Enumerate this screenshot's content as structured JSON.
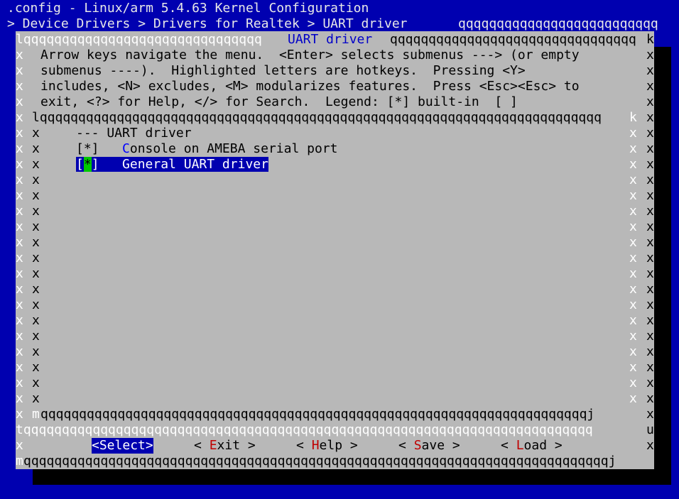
{
  "header": {
    "title": ".config - Linux/arm 5.4.63 Kernel Configuration",
    "breadcrumb": "> Device Drivers > Drivers for Realtek > UART driver"
  },
  "dialog": {
    "title": "UART driver",
    "help_lines": [
      "Arrow keys navigate the menu.  <Enter> selects submenus ---> (or empty",
      "submenus ----).  Highlighted letters are hotkeys.  Pressing <Y>",
      "includes, <N> excludes, <M> modularizes features.  Press <Esc><Esc> to",
      "exit, <?> for Help, </> for Search.  Legend: [*] built-in  [ ]"
    ],
    "menu": {
      "heading": "--- UART driver",
      "items": [
        {
          "box": "[*]",
          "hotkey": "C",
          "rest": "onsole on AMEBA serial port"
        },
        {
          "box_left": "[",
          "box_mark": "*",
          "box_right": "]",
          "label": "General UART driver"
        }
      ]
    },
    "buttons": {
      "select": {
        "left": "<",
        "label": "Select",
        "right": ">"
      },
      "exit": {
        "left": "< ",
        "hotkey": "E",
        "rest": "xit",
        "right": " >"
      },
      "help": {
        "left": "< ",
        "hotkey": "H",
        "rest": "elp",
        "right": " >"
      },
      "save": {
        "left": "< ",
        "hotkey": "S",
        "rest": "ave",
        "right": " >"
      },
      "load": {
        "left": "< ",
        "hotkey": "L",
        "rest": "oad",
        "right": " >"
      }
    }
  },
  "colors": {
    "background": "#0000b0",
    "dialog": "#b8b8b8",
    "accent": "#0000ff",
    "hotkey": "#c00000",
    "cursor": "#00c800"
  }
}
